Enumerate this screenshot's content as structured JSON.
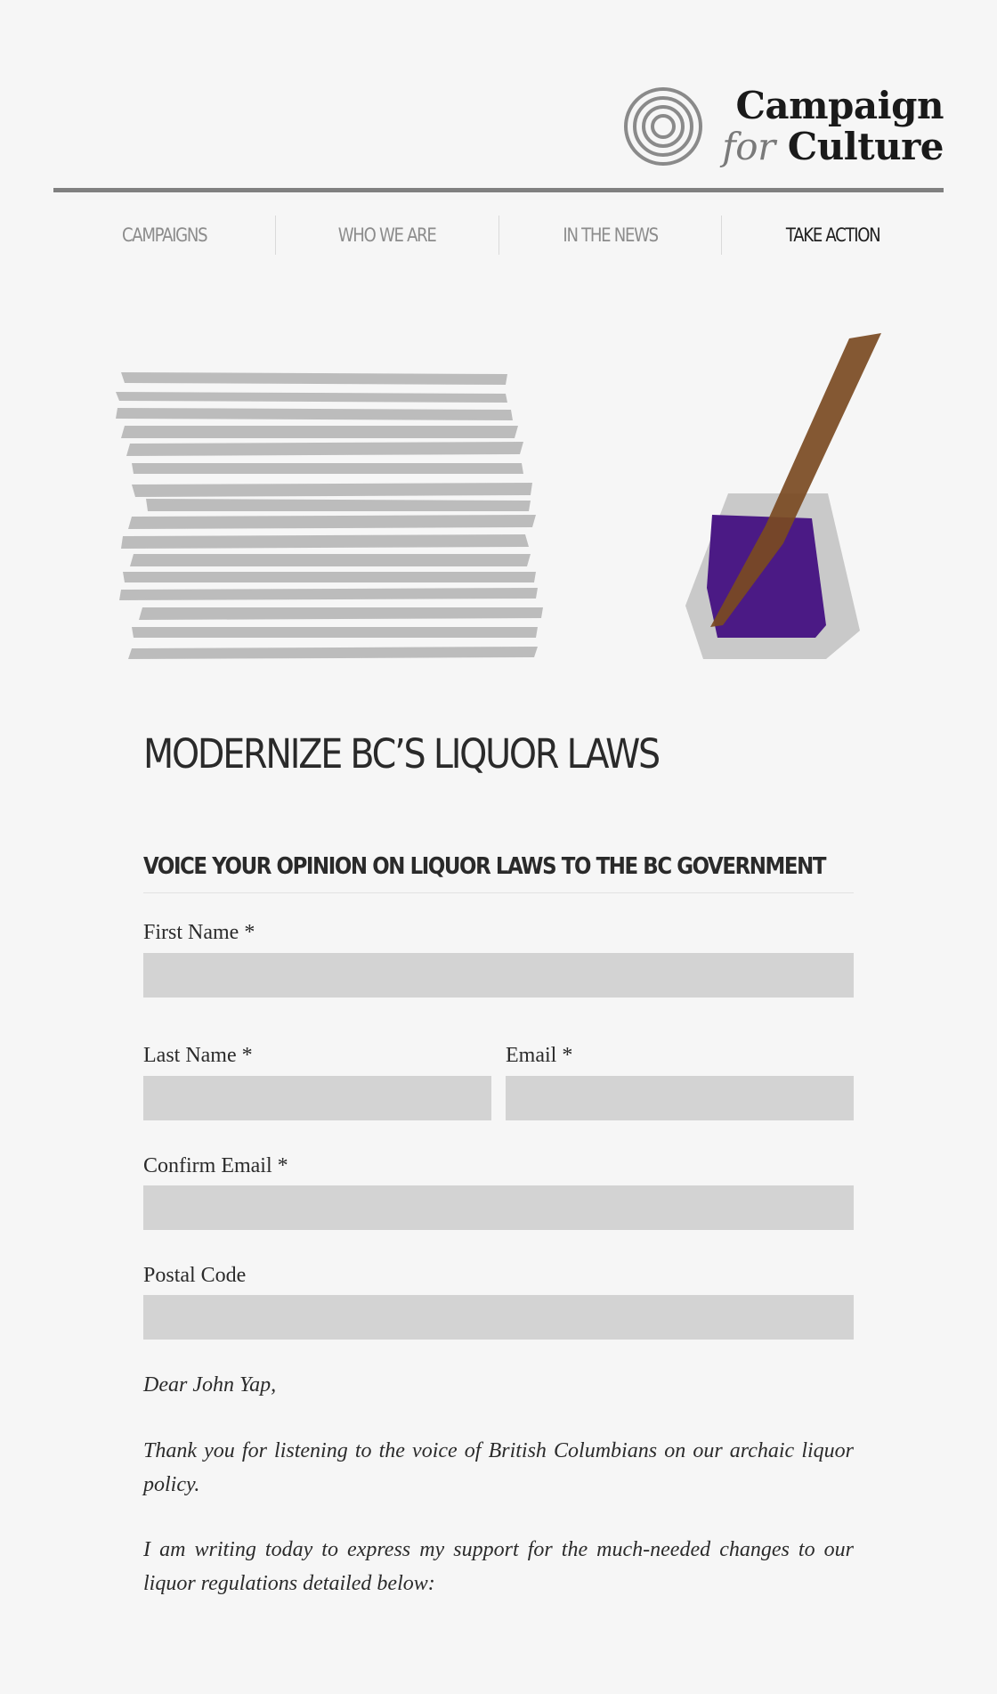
{
  "brand": {
    "line1": "Campaign",
    "line2_for": "for",
    "line2_word": "Culture"
  },
  "nav": {
    "items": [
      {
        "label": "CAMPAIGNS",
        "active": false
      },
      {
        "label": "WHO WE ARE",
        "active": false
      },
      {
        "label": "IN THE NEWS",
        "active": false
      },
      {
        "label": "TAKE ACTION",
        "active": true
      }
    ]
  },
  "page": {
    "title": "MODERNIZE BC’S LIQUOR LAWS"
  },
  "form": {
    "section_title": "VOICE YOUR OPINION ON LIQUOR LAWS TO THE BC GOVERNMENT",
    "required_marker": "*",
    "first_name": {
      "label": "First Name",
      "value": ""
    },
    "last_name": {
      "label": "Last Name",
      "value": ""
    },
    "email": {
      "label": "Email",
      "value": ""
    },
    "confirm_email": {
      "label": "Confirm Email",
      "value": ""
    },
    "postal_code": {
      "label": "Postal Code",
      "value": ""
    }
  },
  "letter": {
    "greeting": "Dear John Yap,",
    "paragraph1": "Thank you for listening to the voice of British Columbians on our archaic liquor policy.",
    "paragraph2": "I am writing today to express my support for the much-needed changes to our liquor regulations detailed below:"
  },
  "colors": {
    "ink": "#4b1a85",
    "pen": "#7a4a22",
    "input_bg": "#d3d3d3",
    "rule": "#808080"
  }
}
